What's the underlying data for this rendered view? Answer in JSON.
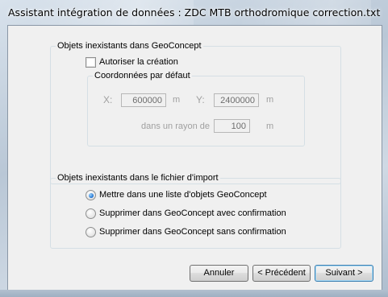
{
  "window": {
    "title": "Assistant intégration de données : ZDC MTB orthodromique correction.txt"
  },
  "group_missing_geoconcept": {
    "label": "Objets inexistants dans GeoConcept",
    "allow_creation_label": "Autoriser la création",
    "allow_creation_checked": false,
    "default_coords": {
      "label": "Coordonnées par défaut",
      "x_label": "X:",
      "x_value": "600000",
      "x_unit": "m",
      "y_label": "Y:",
      "y_value": "2400000",
      "y_unit": "m",
      "radius_label": "dans un rayon de",
      "radius_value": "100",
      "radius_unit": "m"
    }
  },
  "group_missing_import": {
    "label": "Objets inexistants dans le fichier d'import",
    "options": [
      {
        "label": "Mettre dans une liste d'objets GeoConcept",
        "checked": true
      },
      {
        "label": "Supprimer dans GeoConcept avec confirmation",
        "checked": false
      },
      {
        "label": "Supprimer dans GeoConcept sans confirmation",
        "checked": false
      }
    ]
  },
  "buttons": {
    "cancel": "Annuler",
    "previous": "< Précédent",
    "next": "Suivant >"
  }
}
